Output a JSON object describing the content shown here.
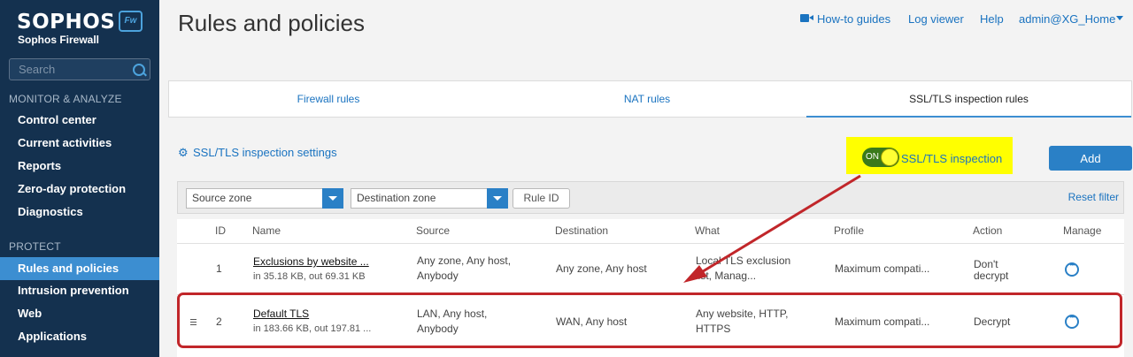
{
  "sidebar": {
    "logo": "SOPHOS",
    "badge": "Fw",
    "product": "Sophos Firewall",
    "search_placeholder": "Search",
    "sections": [
      {
        "title": "MONITOR & ANALYZE",
        "items": [
          {
            "label": "Control center"
          },
          {
            "label": "Current activities"
          },
          {
            "label": "Reports"
          },
          {
            "label": "Zero-day protection"
          },
          {
            "label": "Diagnostics"
          }
        ]
      },
      {
        "title": "PROTECT",
        "items": [
          {
            "label": "Rules and policies",
            "active": true
          },
          {
            "label": "Intrusion prevention"
          },
          {
            "label": "Web"
          },
          {
            "label": "Applications"
          }
        ]
      }
    ]
  },
  "header": {
    "title": "Rules and policies",
    "links": {
      "howto": "How-to guides",
      "log_viewer": "Log viewer",
      "help": "Help",
      "account": "admin@XG_Home"
    }
  },
  "tabs": [
    {
      "label": "Firewall rules"
    },
    {
      "label": "NAT rules"
    },
    {
      "label": "SSL/TLS inspection rules",
      "active": true
    }
  ],
  "controls": {
    "settings_link": "SSL/TLS inspection settings",
    "toggle_state": "ON",
    "toggle_label": "SSL/TLS inspection",
    "add_button": "Add"
  },
  "filters": {
    "source_zone": "Source zone",
    "destination_zone": "Destination zone",
    "rule_id": "Rule ID",
    "reset": "Reset filter"
  },
  "table": {
    "headers": {
      "id": "ID",
      "name": "Name",
      "source": "Source",
      "destination": "Destination",
      "what": "What",
      "profile": "Profile",
      "action": "Action",
      "manage": "Manage"
    },
    "rows": [
      {
        "id": "1",
        "name": "Exclusions by website ...",
        "traffic": "in 35.18 KB, out 69.31 KB",
        "source_1": "Any zone, Any host,",
        "source_2": "Anybody",
        "destination": "Any zone, Any host",
        "what_1": "Local TLS exclusion",
        "what_2": "list, Manag...",
        "profile": "Maximum compati...",
        "action_1": "Don't",
        "action_2": "decrypt"
      },
      {
        "id": "2",
        "name": "Default TLS",
        "traffic": "in 183.66 KB, out 197.81 ...",
        "source_1": "LAN, Any host,",
        "source_2": "Anybody",
        "destination": "WAN, Any host",
        "what_1": "Any website, HTTP,",
        "what_2": "HTTPS",
        "profile": "Maximum compati...",
        "action_1": "Decrypt",
        "action_2": ""
      }
    ]
  },
  "colors": {
    "sidebar_bg": "#14314f",
    "accent": "#2a80c6",
    "highlight": "#ffff00",
    "annotation_red": "#c1262a",
    "toggle_on": "#3a7a1a"
  }
}
